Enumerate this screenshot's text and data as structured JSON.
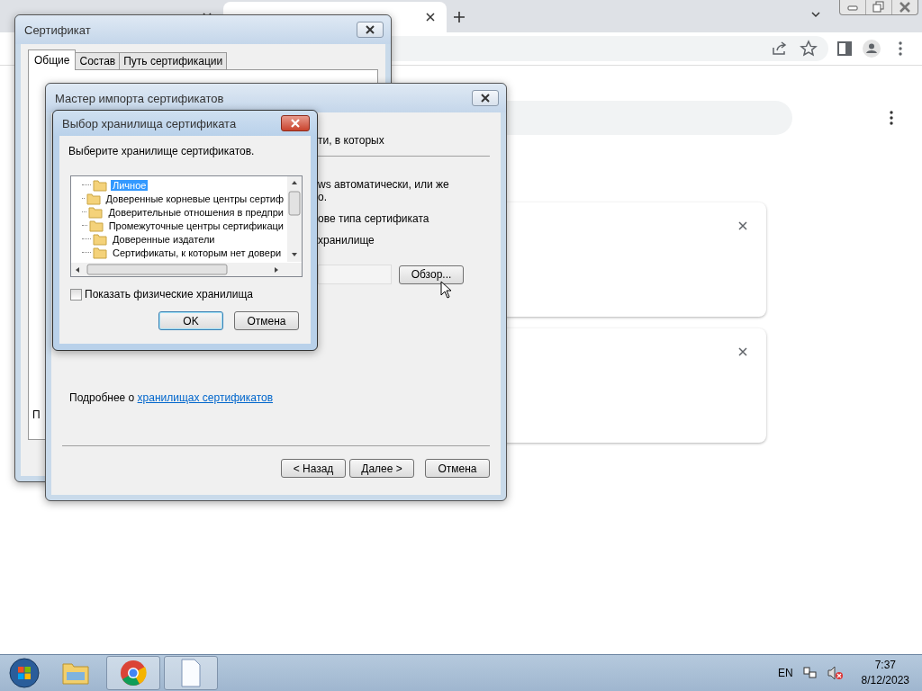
{
  "browser": {
    "tabs": [
      {
        "selected": false
      },
      {
        "selected": true
      }
    ]
  },
  "certificate_window": {
    "title": "Сертификат",
    "tabs": [
      {
        "label": "Общие",
        "selected": true
      },
      {
        "label": "Состав",
        "selected": false
      },
      {
        "label": "Путь сертификации",
        "selected": false
      }
    ],
    "fragment": "П"
  },
  "import_wizard": {
    "title": "Мастер импорта сертификатов",
    "fragments": [
      "ти, в которых",
      "ws автоматически, или же",
      "о.",
      "ове типа сертификата",
      "хранилище"
    ],
    "browse_button": "Обзор...",
    "more_text": "Подробнее о ",
    "more_link": "хранилищах сертификатов",
    "buttons": [
      "< Назад",
      "Далее >",
      "Отмена"
    ]
  },
  "store_dialog": {
    "title": "Выбор хранилища сертификата",
    "prompt": "Выберите хранилище сертификатов.",
    "stores": [
      {
        "label": "Личное",
        "selected": true
      },
      {
        "label": "Доверенные корневые центры сертиф",
        "selected": false
      },
      {
        "label": "Доверительные отношения в предпри",
        "selected": false
      },
      {
        "label": "Промежуточные центры сертификаци",
        "selected": false
      },
      {
        "label": "Доверенные издатели",
        "selected": false
      },
      {
        "label": "Сертификаты, к которым нет довери",
        "selected": false
      }
    ],
    "show_physical": {
      "label": "Показать физические хранилища",
      "checked": false
    },
    "buttons": [
      "OK",
      "Отмена"
    ]
  },
  "taskbar": {
    "language": "EN",
    "time": "7:37",
    "date": "8/12/2023"
  }
}
